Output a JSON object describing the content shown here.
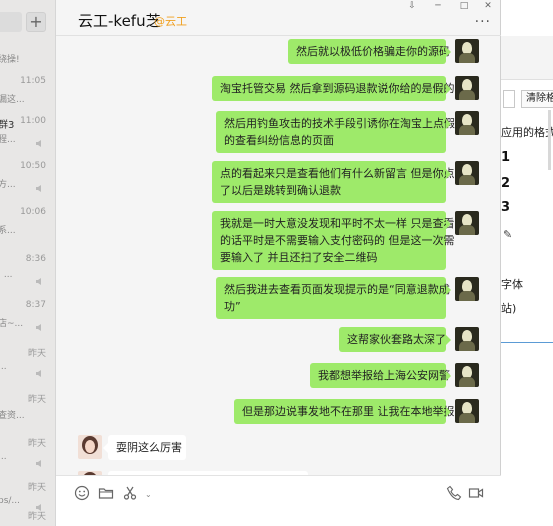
{
  "left_list": {
    "items": [
      {
        "name": "",
        "time": "",
        "snippet": "绕操!",
        "muted": false
      },
      {
        "name": "",
        "time": "11:05",
        "snippet": "漏这...",
        "muted": false
      },
      {
        "name": "群3",
        "time": "11:00",
        "snippet": "程...",
        "muted": true
      },
      {
        "name": "",
        "time": "10:50",
        "snippet": "方...",
        "muted": true
      },
      {
        "name": "",
        "time": "10:06",
        "snippet": "系...",
        "muted": false
      },
      {
        "name": "",
        "time": "8:36",
        "snippet": ": ...",
        "muted": true
      },
      {
        "name": "",
        "time": "8:37",
        "snippet": "店~...",
        "muted": true
      },
      {
        "name": "",
        "time": "昨天",
        "snippet": "...",
        "muted": true
      },
      {
        "name": "",
        "time": "昨天",
        "snippet": "查资...",
        "muted": false
      },
      {
        "name": "",
        "time": "昨天",
        "snippet": "...",
        "muted": true
      },
      {
        "name": "",
        "time": "昨天",
        "snippet": "ps/...",
        "muted": true
      },
      {
        "name": "",
        "time": "昨天",
        "snippet": "",
        "muted": true
      }
    ]
  },
  "chat": {
    "title": "云工-kefu芝",
    "title_suffix": "@云工",
    "window_buttons": [
      "⇩",
      "─",
      "□",
      "✕"
    ],
    "more_label": "···",
    "messages": [
      {
        "side": "right",
        "lines": [
          "然后就以极低价格骗走你的源码"
        ]
      },
      {
        "side": "right",
        "lines": [
          "淘宝托管交易 然后拿到源码退款说你给的是假的"
        ]
      },
      {
        "side": "right",
        "lines": [
          "然后用钓鱼攻击的技术手段引诱你在淘宝上点假",
          "的查看纠纷信息的页面"
        ]
      },
      {
        "side": "right",
        "lines": [
          "点的看起来只是查看他们有什么新留言 但是你点",
          "了以后是跳转到确认退款"
        ]
      },
      {
        "side": "right",
        "lines": [
          "我就是一时大意没发现和平时不太一样 只是查看",
          "的话平时是不需要输入支付密码的 但是这一次需",
          "要输入了 并且还扫了安全二维码"
        ]
      },
      {
        "side": "right",
        "lines": [
          "然后我进去查看页面发现提示的是“同意退款成",
          "功”"
        ]
      },
      {
        "side": "right",
        "lines": [
          "这帮家伙套路太深了"
        ]
      },
      {
        "side": "right",
        "lines": [
          "我都想举报给上海公安网警"
        ]
      },
      {
        "side": "right",
        "lines": [
          "但是那边说事发地不在那里 让我在本地举报"
        ]
      },
      {
        "side": "left",
        "lines": [
          "耍阴这么厉害"
        ]
      },
      {
        "side": "left",
        "lines": [
          ""
        ]
      }
    ]
  },
  "input_toolbar": {
    "icons": [
      "emoji-icon",
      "folder-icon",
      "scissors-icon",
      "phone-icon",
      "video-icon"
    ]
  },
  "background_app": {
    "clear_label": "清除格",
    "format_text": "应用的格式",
    "numbers": [
      "1",
      "2",
      "3"
    ],
    "font_text": "字体",
    "site_text": "站)"
  }
}
